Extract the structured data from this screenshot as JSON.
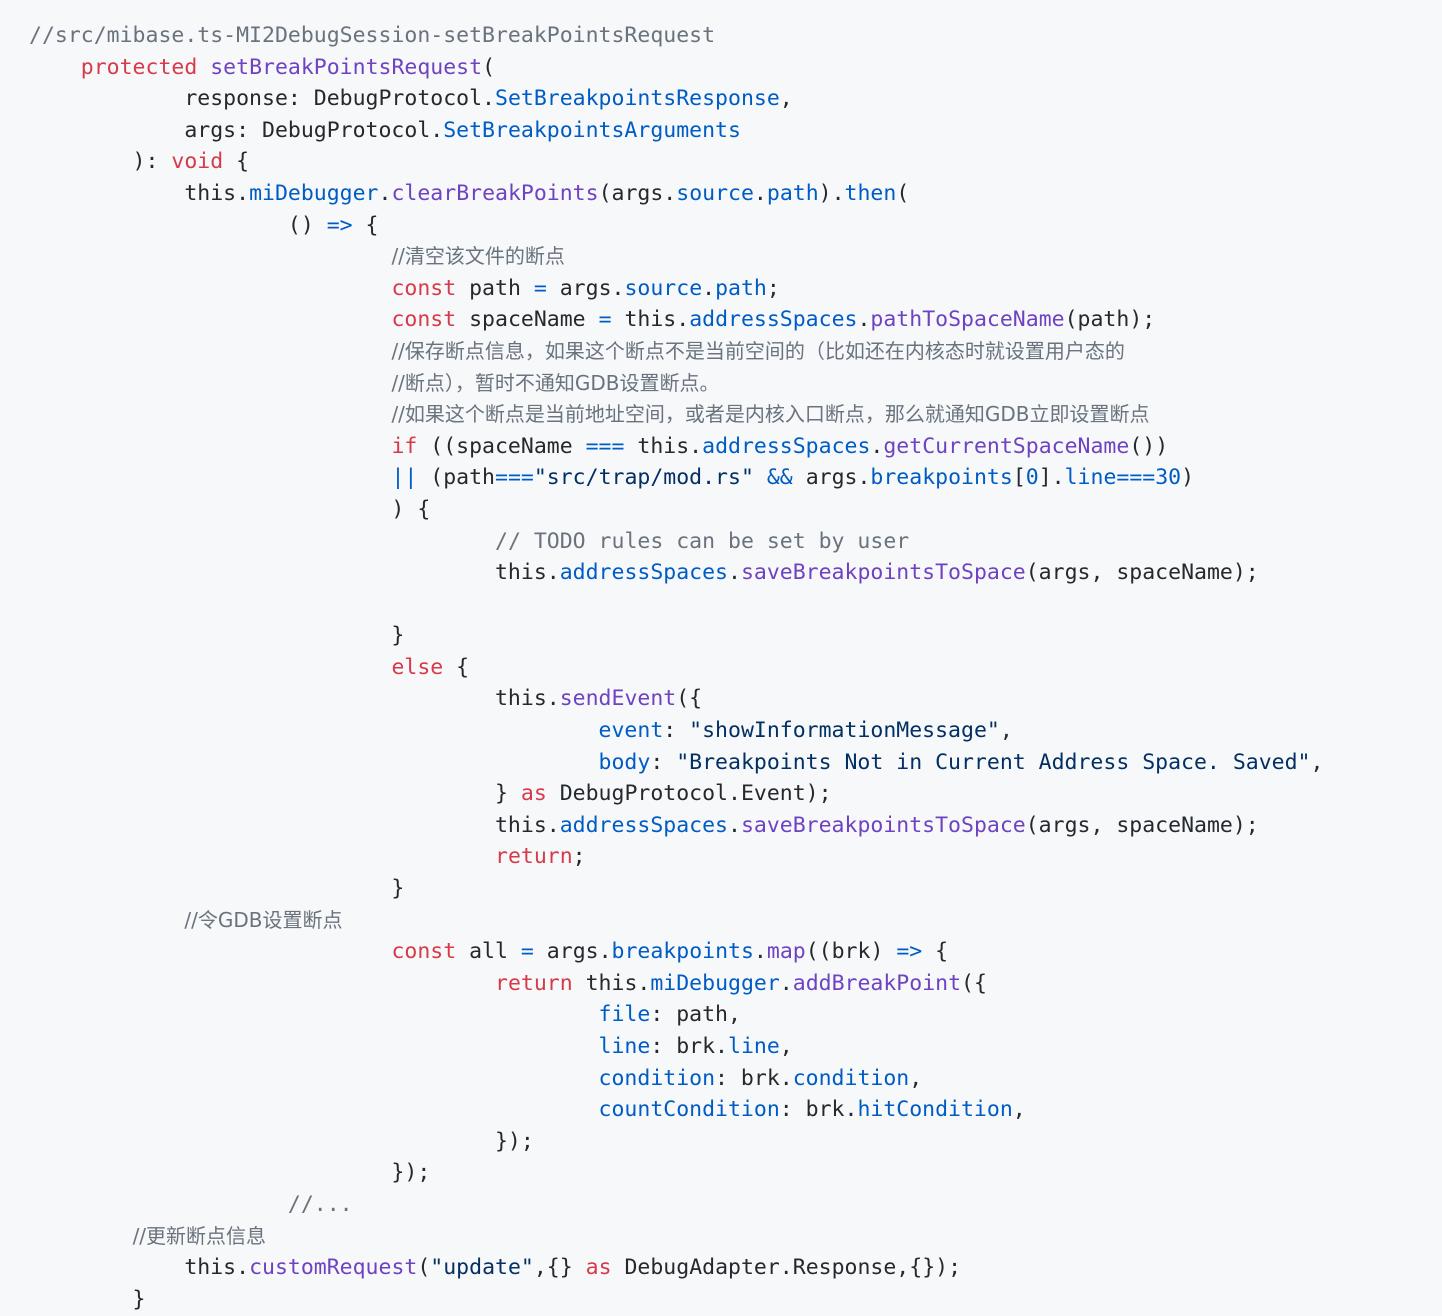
{
  "code": {
    "lines": [
      [
        {
          "t": "//src/mibase.ts-MI2DebugSession-setBreakPointsRequest",
          "k": "comment"
        }
      ],
      [
        {
          "t": "    ",
          "k": "plain"
        },
        {
          "t": "protected",
          "k": "keyword"
        },
        {
          "t": " ",
          "k": "plain"
        },
        {
          "t": "setBreakPointsRequest",
          "k": "func"
        },
        {
          "t": "(",
          "k": "plain"
        }
      ],
      [
        {
          "t": "            response: DebugProtocol.",
          "k": "plain"
        },
        {
          "t": "SetBreakpointsResponse",
          "k": "prop"
        },
        {
          "t": ",",
          "k": "plain"
        }
      ],
      [
        {
          "t": "            args: DebugProtocol.",
          "k": "plain"
        },
        {
          "t": "SetBreakpointsArguments",
          "k": "prop"
        }
      ],
      [
        {
          "t": "        ): ",
          "k": "plain"
        },
        {
          "t": "void",
          "k": "keyword"
        },
        {
          "t": " {",
          "k": "plain"
        }
      ],
      [
        {
          "t": "            this.",
          "k": "plain"
        },
        {
          "t": "miDebugger",
          "k": "prop"
        },
        {
          "t": ".",
          "k": "plain"
        },
        {
          "t": "clearBreakPoints",
          "k": "func"
        },
        {
          "t": "(args.",
          "k": "plain"
        },
        {
          "t": "source",
          "k": "prop"
        },
        {
          "t": ".",
          "k": "plain"
        },
        {
          "t": "path",
          "k": "prop"
        },
        {
          "t": ").",
          "k": "plain"
        },
        {
          "t": "then",
          "k": "prop"
        },
        {
          "t": "(",
          "k": "plain"
        }
      ],
      [
        {
          "t": "                    () ",
          "k": "plain"
        },
        {
          "t": "=>",
          "k": "prop"
        },
        {
          "t": " {",
          "k": "plain"
        }
      ],
      [
        {
          "t": "                            ",
          "k": "plain"
        },
        {
          "t": "//清空该文件的断点",
          "k": "comment-cjk"
        }
      ],
      [
        {
          "t": "                            ",
          "k": "plain"
        },
        {
          "t": "const",
          "k": "keyword"
        },
        {
          "t": " path ",
          "k": "plain"
        },
        {
          "t": "=",
          "k": "prop"
        },
        {
          "t": " args.",
          "k": "plain"
        },
        {
          "t": "source",
          "k": "prop"
        },
        {
          "t": ".",
          "k": "plain"
        },
        {
          "t": "path",
          "k": "prop"
        },
        {
          "t": ";",
          "k": "plain"
        }
      ],
      [
        {
          "t": "                            ",
          "k": "plain"
        },
        {
          "t": "const",
          "k": "keyword"
        },
        {
          "t": " spaceName ",
          "k": "plain"
        },
        {
          "t": "=",
          "k": "prop"
        },
        {
          "t": " this.",
          "k": "plain"
        },
        {
          "t": "addressSpaces",
          "k": "prop"
        },
        {
          "t": ".",
          "k": "plain"
        },
        {
          "t": "pathToSpaceName",
          "k": "func"
        },
        {
          "t": "(path);",
          "k": "plain"
        }
      ],
      [
        {
          "t": "                            ",
          "k": "plain"
        },
        {
          "t": "//保存断点信息，如果这个断点不是当前空间的（比如还在内核态时就设置用户态的",
          "k": "comment-cjk"
        }
      ],
      [
        {
          "t": "                            ",
          "k": "plain"
        },
        {
          "t": "//断点），暂时不通知GDB设置断点。",
          "k": "comment-cjk"
        }
      ],
      [
        {
          "t": "                            ",
          "k": "plain"
        },
        {
          "t": "//如果这个断点是当前地址空间，或者是内核入口断点，那么就通知GDB立即设置断点",
          "k": "comment-cjk"
        }
      ],
      [
        {
          "t": "                            ",
          "k": "plain"
        },
        {
          "t": "if",
          "k": "keyword"
        },
        {
          "t": " ((spaceName ",
          "k": "plain"
        },
        {
          "t": "===",
          "k": "prop"
        },
        {
          "t": " this.",
          "k": "plain"
        },
        {
          "t": "addressSpaces",
          "k": "prop"
        },
        {
          "t": ".",
          "k": "plain"
        },
        {
          "t": "getCurrentSpaceName",
          "k": "func"
        },
        {
          "t": "())",
          "k": "plain"
        }
      ],
      [
        {
          "t": "                            ",
          "k": "plain"
        },
        {
          "t": "||",
          "k": "prop"
        },
        {
          "t": " (path",
          "k": "plain"
        },
        {
          "t": "===",
          "k": "prop"
        },
        {
          "t": "\"src/trap/mod.rs\"",
          "k": "string"
        },
        {
          "t": " ",
          "k": "plain"
        },
        {
          "t": "&&",
          "k": "prop"
        },
        {
          "t": " args.",
          "k": "plain"
        },
        {
          "t": "breakpoints",
          "k": "prop"
        },
        {
          "t": "[",
          "k": "plain"
        },
        {
          "t": "0",
          "k": "number"
        },
        {
          "t": "].",
          "k": "plain"
        },
        {
          "t": "line",
          "k": "prop"
        },
        {
          "t": "===",
          "k": "prop"
        },
        {
          "t": "30",
          "k": "number"
        },
        {
          "t": ")",
          "k": "plain"
        }
      ],
      [
        {
          "t": "                            ) {",
          "k": "plain"
        }
      ],
      [
        {
          "t": "                                    ",
          "k": "plain"
        },
        {
          "t": "// TODO rules can be set by user",
          "k": "comment"
        }
      ],
      [
        {
          "t": "                                    this.",
          "k": "plain"
        },
        {
          "t": "addressSpaces",
          "k": "prop"
        },
        {
          "t": ".",
          "k": "plain"
        },
        {
          "t": "saveBreakpointsToSpace",
          "k": "func"
        },
        {
          "t": "(args, spaceName);",
          "k": "plain"
        }
      ],
      [
        {
          "t": "",
          "k": "plain"
        }
      ],
      [
        {
          "t": "                            }",
          "k": "plain"
        }
      ],
      [
        {
          "t": "                            ",
          "k": "plain"
        },
        {
          "t": "else",
          "k": "keyword"
        },
        {
          "t": " {",
          "k": "plain"
        }
      ],
      [
        {
          "t": "                                    this.",
          "k": "plain"
        },
        {
          "t": "sendEvent",
          "k": "func"
        },
        {
          "t": "({",
          "k": "plain"
        }
      ],
      [
        {
          "t": "                                            ",
          "k": "plain"
        },
        {
          "t": "event",
          "k": "prop"
        },
        {
          "t": ": ",
          "k": "plain"
        },
        {
          "t": "\"showInformationMessage\"",
          "k": "string"
        },
        {
          "t": ",",
          "k": "plain"
        }
      ],
      [
        {
          "t": "                                            ",
          "k": "plain"
        },
        {
          "t": "body",
          "k": "prop"
        },
        {
          "t": ": ",
          "k": "plain"
        },
        {
          "t": "\"Breakpoints Not in Current Address Space. Saved\"",
          "k": "string"
        },
        {
          "t": ",",
          "k": "plain"
        }
      ],
      [
        {
          "t": "                                    } ",
          "k": "plain"
        },
        {
          "t": "as",
          "k": "keyword"
        },
        {
          "t": " DebugProtocol.Event);",
          "k": "plain"
        }
      ],
      [
        {
          "t": "                                    this.",
          "k": "plain"
        },
        {
          "t": "addressSpaces",
          "k": "prop"
        },
        {
          "t": ".",
          "k": "plain"
        },
        {
          "t": "saveBreakpointsToSpace",
          "k": "func"
        },
        {
          "t": "(args, spaceName);",
          "k": "plain"
        }
      ],
      [
        {
          "t": "                                    ",
          "k": "plain"
        },
        {
          "t": "return",
          "k": "keyword"
        },
        {
          "t": ";",
          "k": "plain"
        }
      ],
      [
        {
          "t": "                            }",
          "k": "plain"
        }
      ],
      [
        {
          "t": "            ",
          "k": "plain"
        },
        {
          "t": "//令GDB设置断点",
          "k": "comment-cjk"
        }
      ],
      [
        {
          "t": "                            ",
          "k": "plain"
        },
        {
          "t": "const",
          "k": "keyword"
        },
        {
          "t": " all ",
          "k": "plain"
        },
        {
          "t": "=",
          "k": "prop"
        },
        {
          "t": " args.",
          "k": "plain"
        },
        {
          "t": "breakpoints",
          "k": "prop"
        },
        {
          "t": ".",
          "k": "plain"
        },
        {
          "t": "map",
          "k": "func"
        },
        {
          "t": "((brk) ",
          "k": "plain"
        },
        {
          "t": "=>",
          "k": "prop"
        },
        {
          "t": " {",
          "k": "plain"
        }
      ],
      [
        {
          "t": "                                    ",
          "k": "plain"
        },
        {
          "t": "return",
          "k": "keyword"
        },
        {
          "t": " this.",
          "k": "plain"
        },
        {
          "t": "miDebugger",
          "k": "prop"
        },
        {
          "t": ".",
          "k": "plain"
        },
        {
          "t": "addBreakPoint",
          "k": "func"
        },
        {
          "t": "({",
          "k": "plain"
        }
      ],
      [
        {
          "t": "                                            ",
          "k": "plain"
        },
        {
          "t": "file",
          "k": "prop"
        },
        {
          "t": ": path,",
          "k": "plain"
        }
      ],
      [
        {
          "t": "                                            ",
          "k": "plain"
        },
        {
          "t": "line",
          "k": "prop"
        },
        {
          "t": ": brk.",
          "k": "plain"
        },
        {
          "t": "line",
          "k": "prop"
        },
        {
          "t": ",",
          "k": "plain"
        }
      ],
      [
        {
          "t": "                                            ",
          "k": "plain"
        },
        {
          "t": "condition",
          "k": "prop"
        },
        {
          "t": ": brk.",
          "k": "plain"
        },
        {
          "t": "condition",
          "k": "prop"
        },
        {
          "t": ",",
          "k": "plain"
        }
      ],
      [
        {
          "t": "                                            ",
          "k": "plain"
        },
        {
          "t": "countCondition",
          "k": "prop"
        },
        {
          "t": ": brk.",
          "k": "plain"
        },
        {
          "t": "hitCondition",
          "k": "prop"
        },
        {
          "t": ",",
          "k": "plain"
        }
      ],
      [
        {
          "t": "                                    });",
          "k": "plain"
        }
      ],
      [
        {
          "t": "                            });",
          "k": "plain"
        }
      ],
      [
        {
          "t": "                    ",
          "k": "plain"
        },
        {
          "t": "//...",
          "k": "comment"
        }
      ],
      [
        {
          "t": "        ",
          "k": "plain"
        },
        {
          "t": "//更新断点信息",
          "k": "comment-cjk"
        }
      ],
      [
        {
          "t": "            this.",
          "k": "plain"
        },
        {
          "t": "customRequest",
          "k": "func"
        },
        {
          "t": "(",
          "k": "plain"
        },
        {
          "t": "\"update\"",
          "k": "string"
        },
        {
          "t": ",{} ",
          "k": "plain"
        },
        {
          "t": "as",
          "k": "keyword"
        },
        {
          "t": " DebugAdapter.Response,{});",
          "k": "plain"
        }
      ],
      [
        {
          "t": "        }",
          "k": "plain"
        }
      ]
    ]
  },
  "colors": {
    "background": "#f6f8fa",
    "keyword": "#d73a49",
    "function": "#6f42c1",
    "property": "#005cc5",
    "string": "#032f62",
    "comment": "#6a737d",
    "text": "#24292e"
  }
}
